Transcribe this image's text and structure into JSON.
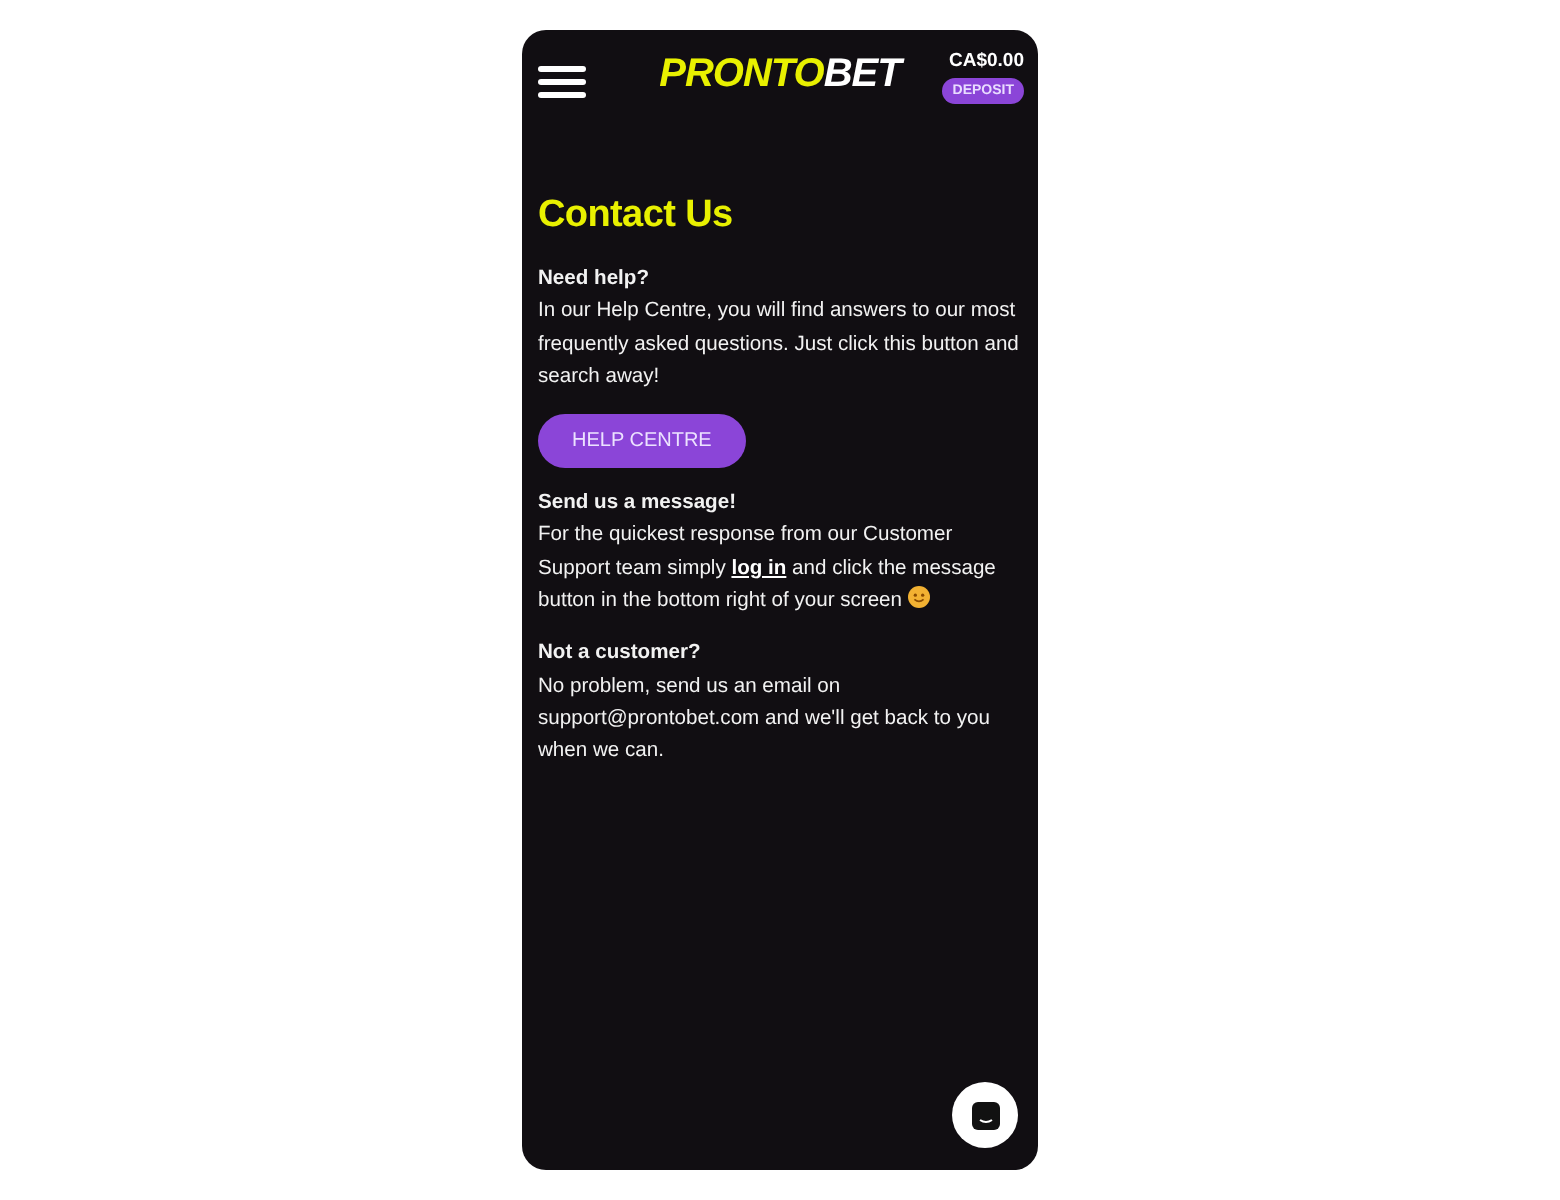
{
  "header": {
    "logo": {
      "primary": "PRONTO",
      "secondary": "BET"
    },
    "balance": "CA$0.00",
    "deposit_button": "DEPOSIT"
  },
  "title": "Contact Us",
  "sections": [
    {
      "heading": "Need help?",
      "body": [
        {
          "kind": "text",
          "text": "In our Help Centre, you will find answers to our most frequently asked questions. Just click this button and search away!"
        }
      ],
      "button": "HELP CENTRE"
    },
    {
      "heading": "Send us a message!",
      "body": [
        {
          "kind": "text",
          "text": "For the quickest response from our Customer Support team simply "
        },
        {
          "kind": "link",
          "text": "log in"
        },
        {
          "kind": "text",
          "text": " and click the message button in the bottom right of your screen "
        },
        {
          "kind": "smiley"
        }
      ]
    },
    {
      "heading": "Not a customer?",
      "body": [
        {
          "kind": "text",
          "text": "No problem, send us an email on support@prontobet.com and we'll get back to you when we can."
        }
      ]
    }
  ]
}
